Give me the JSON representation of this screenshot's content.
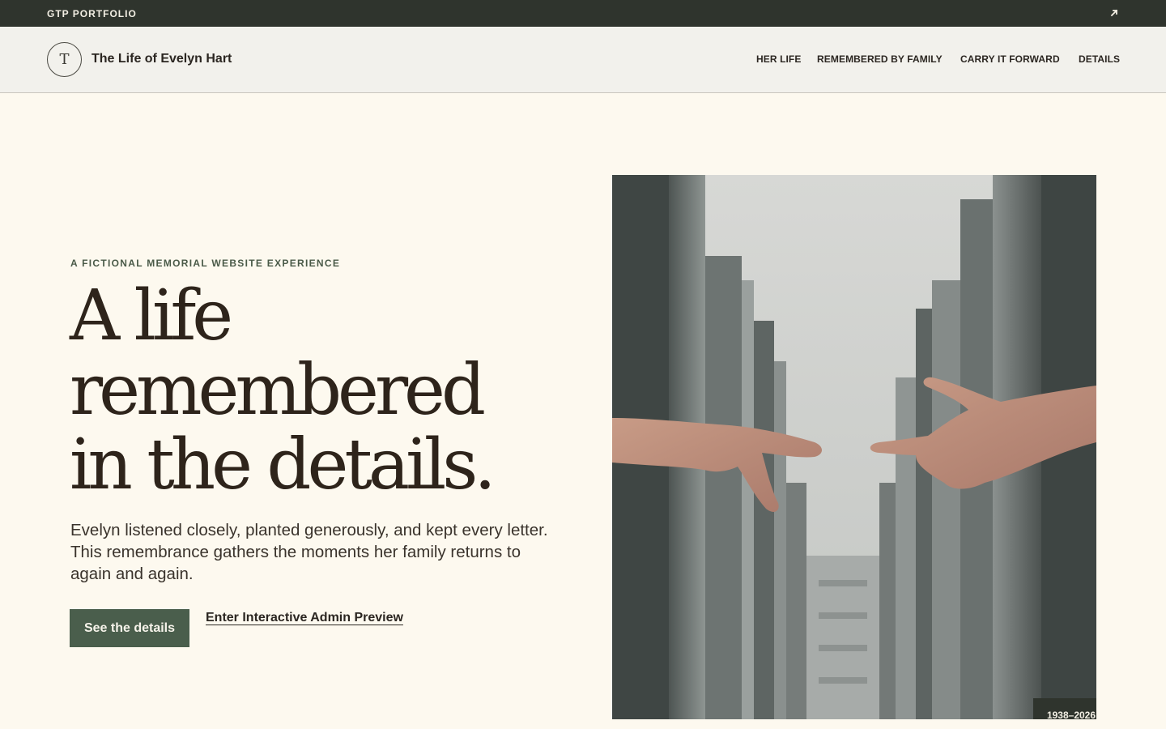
{
  "topbar": {
    "brand": "GTP PORTFOLIO",
    "external_icon": "external-link-icon"
  },
  "header": {
    "monogram": "T",
    "title": "The Life of Evelyn Hart",
    "nav": [
      {
        "label": "HER LIFE"
      },
      {
        "label": "REMEMBERED BY FAMILY"
      },
      {
        "label": "CARRY IT FORWARD"
      },
      {
        "label": "DETAILS"
      }
    ]
  },
  "hero": {
    "eyebrow": "A FICTIONAL MEMORIAL WEBSITE EXPERIENCE",
    "headline": [
      "A life",
      "remembered",
      "in the details."
    ],
    "lede": "Evelyn listened closely, planted generously, and kept every letter. This remembrance gathers the moments her family returns to again and again.",
    "primary_button": "See the details",
    "secondary_link": "Enter Interactive Admin Preview"
  },
  "photo": {
    "dates": "1938–2026"
  },
  "colors": {
    "background": "#fdf9ef",
    "topbar": "#2f342d",
    "accent": "#4a5e4c",
    "text": "#2e241b"
  }
}
